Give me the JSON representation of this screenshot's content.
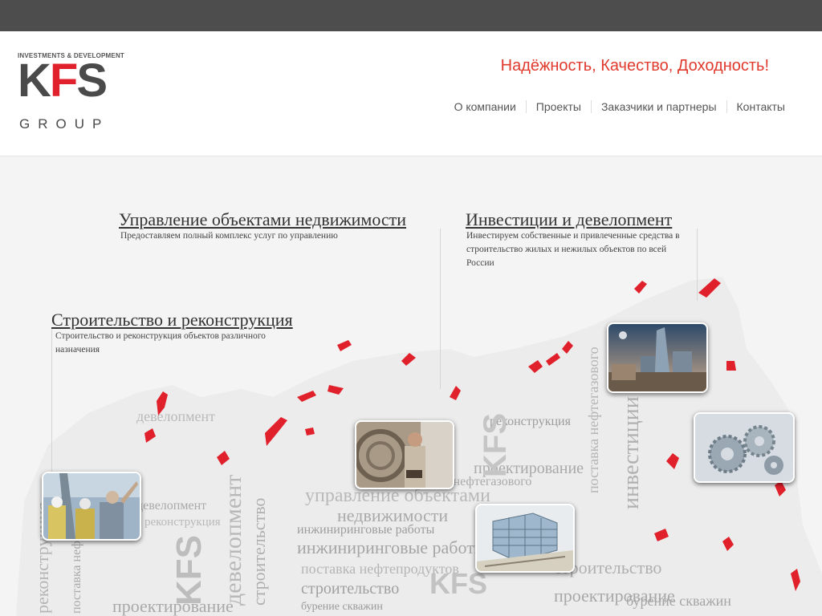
{
  "header": {
    "logo": {
      "sub": "INVESTMENTS & DEVELOPMENT",
      "main_left": "K",
      "main_red": "F",
      "main_right": "S",
      "group": "GROUP"
    },
    "slogan": "Надёжность, Качество, Доходность!",
    "nav": [
      "О компании",
      "Проекты",
      "Заказчики и партнеры",
      "Контакты"
    ]
  },
  "sections": [
    {
      "title": "Управление объектами недвижимости",
      "desc": "Предоставляем полный комплекс услуг по управлению"
    },
    {
      "title": "Инвестиции и девелопмент",
      "desc": "Инвестируем собственные и привлеченные средства в строительство жилых и нежилых объектов по всей России"
    },
    {
      "title": "Строительство и реконструкция",
      "desc": "Строительство и реконструкция объектов различного назначения"
    }
  ],
  "map_words": [
    "управление объектами",
    "недвижимости",
    "инжиниринговые работы",
    "поставка нефтепродуктов",
    "строительство",
    "KFS",
    "девелопмент",
    "инвестиции",
    "проектирование",
    "бурение скважин",
    "реконструкция",
    "поставка нефтегазового",
    "инжиниринговые ра"
  ],
  "colors": {
    "topbar": "#4d4d4d",
    "accent": "#e03a2e",
    "map_red": "#e0202a"
  }
}
